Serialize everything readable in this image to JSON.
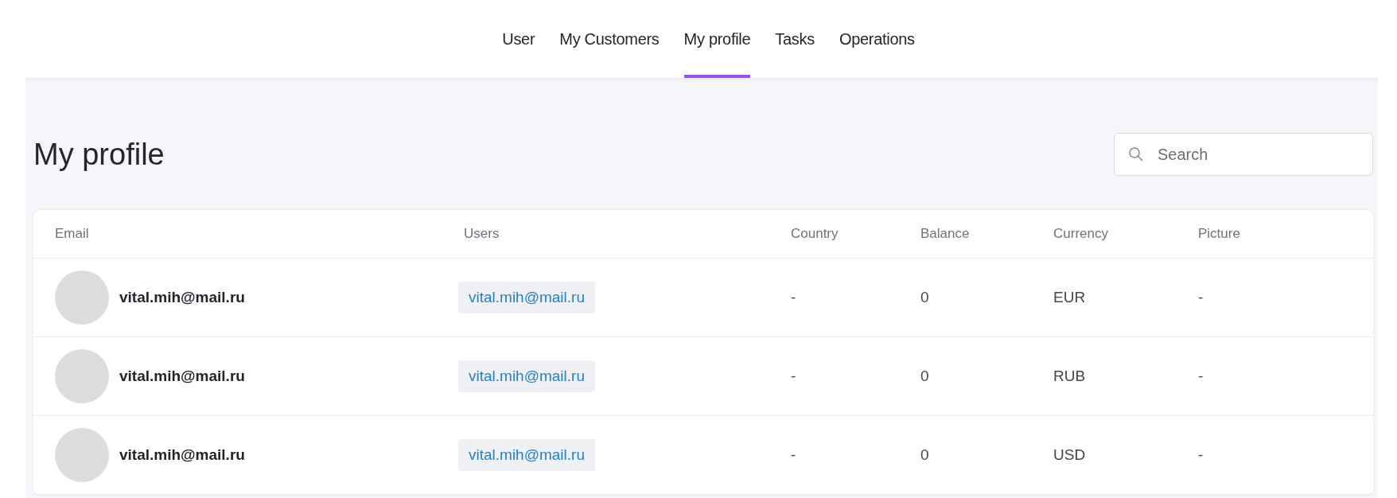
{
  "tabs": [
    {
      "label": "User",
      "selected": false
    },
    {
      "label": "My Customers",
      "selected": false
    },
    {
      "label": "My profile",
      "selected": true
    },
    {
      "label": "Tasks",
      "selected": false
    },
    {
      "label": "Operations",
      "selected": false
    }
  ],
  "page": {
    "title": "My profile",
    "search": {
      "placeholder": "Search"
    }
  },
  "table": {
    "columns": [
      "Email",
      "Users",
      "Country",
      "Balance",
      "Currency",
      "Picture"
    ],
    "rows": [
      {
        "email": "vital.mih@mail.ru",
        "user": "vital.mih@mail.ru",
        "country": "-",
        "balance": "0",
        "currency": "EUR",
        "picture": "-"
      },
      {
        "email": "vital.mih@mail.ru",
        "user": "vital.mih@mail.ru",
        "country": "-",
        "balance": "0",
        "currency": "RUB",
        "picture": "-"
      },
      {
        "email": "vital.mih@mail.ru",
        "user": "vital.mih@mail.ru",
        "country": "-",
        "balance": "0",
        "currency": "USD",
        "picture": "-"
      }
    ]
  }
}
